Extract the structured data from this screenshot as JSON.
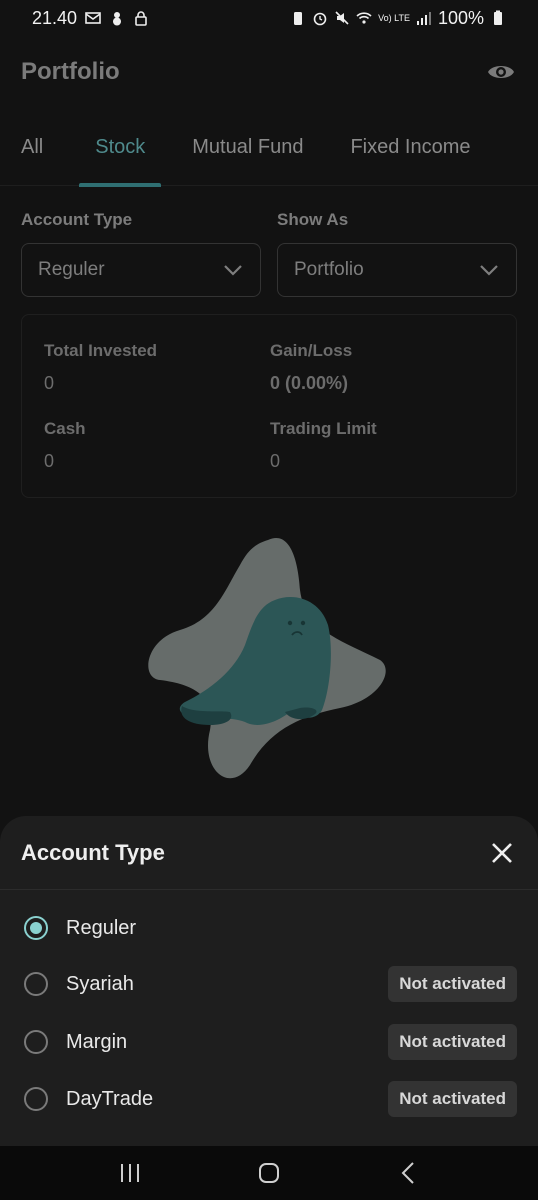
{
  "status_bar": {
    "time": "21.40",
    "battery": "100%",
    "network": "Vo) LTE"
  },
  "app_bar": {
    "title": "Portfolio",
    "visibility_icon": "eye-icon"
  },
  "tabs": [
    {
      "label": "All",
      "active": false
    },
    {
      "label": "Stock",
      "active": true
    },
    {
      "label": "Mutual Fund",
      "active": false
    },
    {
      "label": "Fixed Income",
      "active": false
    }
  ],
  "filters": {
    "account_type": {
      "label": "Account Type",
      "value": "Reguler"
    },
    "show_as": {
      "label": "Show As",
      "value": "Portfolio"
    }
  },
  "summary": {
    "total_invested": {
      "label": "Total Invested",
      "value": "0"
    },
    "gain_loss": {
      "label": "Gain/Loss",
      "value": "0 (0.00%)"
    },
    "cash": {
      "label": "Cash",
      "value": "0"
    },
    "trading_limit": {
      "label": "Trading Limit",
      "value": "0"
    }
  },
  "sheet": {
    "title": "Account Type",
    "options": [
      {
        "label": "Reguler",
        "selected": true,
        "badge": ""
      },
      {
        "label": "Syariah",
        "selected": false,
        "badge": "Not activated"
      },
      {
        "label": "Margin",
        "selected": false,
        "badge": "Not activated"
      },
      {
        "label": "DayTrade",
        "selected": false,
        "badge": "Not activated"
      }
    ]
  },
  "colors": {
    "accent": "#4f8a8c",
    "radio_selected": "#8ad1cf",
    "background": "#121212",
    "sheet": "#1e1e1e"
  }
}
